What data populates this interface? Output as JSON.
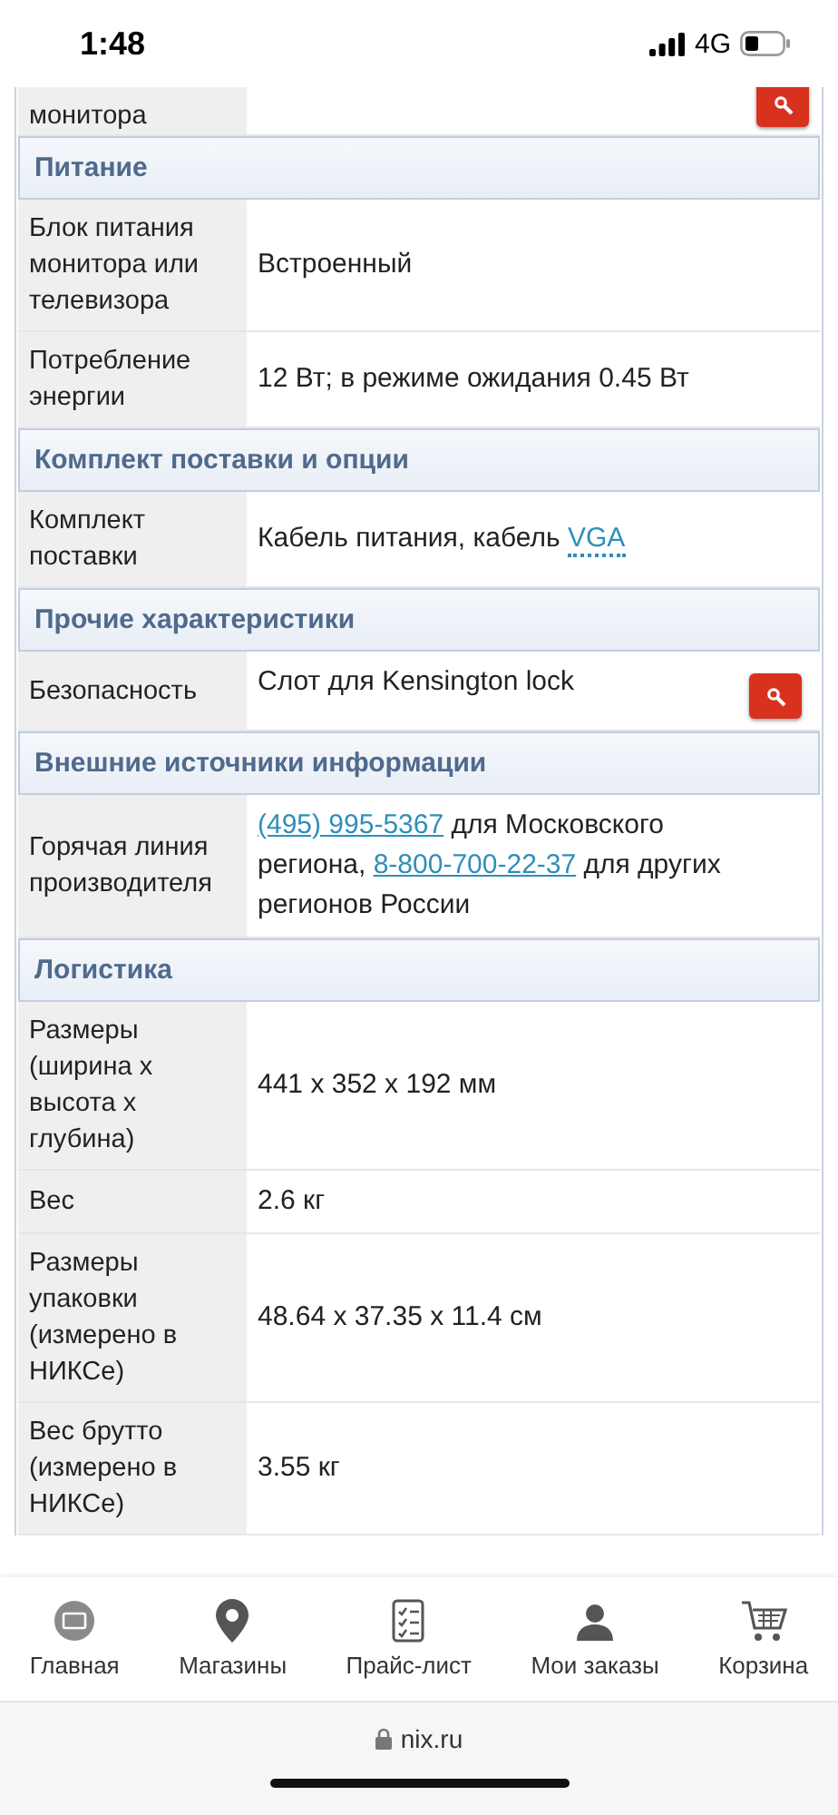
{
  "status_bar": {
    "time": "1:48",
    "network": "4G"
  },
  "spec_rows": [
    {
      "kind": "row",
      "label": "монитора",
      "partial": true,
      "search": true,
      "parts": []
    },
    {
      "kind": "header",
      "label": "Питание"
    },
    {
      "kind": "row",
      "label": "Блок питания монитора или телевизора",
      "partial": false,
      "search": false,
      "parts": [
        {
          "kind": "text",
          "text": "Встроенный"
        }
      ]
    },
    {
      "kind": "row",
      "label": "Потребление энергии",
      "partial": false,
      "search": false,
      "parts": [
        {
          "kind": "text",
          "text": "12 Вт; в режиме ожидания 0.45 Вт"
        }
      ]
    },
    {
      "kind": "header",
      "label": "Комплект поставки и опции"
    },
    {
      "kind": "row",
      "label": "Комплект поставки",
      "partial": false,
      "search": false,
      "parts": [
        {
          "kind": "text",
          "text": "Кабель питания, кабель "
        },
        {
          "kind": "term",
          "text": "VGA"
        }
      ]
    },
    {
      "kind": "header",
      "label": "Прочие характеристики"
    },
    {
      "kind": "row",
      "label": "Безопасность",
      "partial": false,
      "search": true,
      "parts": [
        {
          "kind": "text",
          "text": "Слот для Kensington lock"
        }
      ]
    },
    {
      "kind": "header",
      "label": "Внешние источники информации"
    },
    {
      "kind": "row",
      "label": "Горячая линия производителя",
      "partial": false,
      "search": false,
      "parts": [
        {
          "kind": "link",
          "text": "(495) 995-5367"
        },
        {
          "kind": "text",
          "text": " для Московского региона, "
        },
        {
          "kind": "link",
          "text": "8-800-700-22-37"
        },
        {
          "kind": "text",
          "text": " для других регионов России"
        }
      ]
    },
    {
      "kind": "header",
      "label": "Логистика"
    },
    {
      "kind": "row",
      "label": "Размеры (ширина x высота x глубина)",
      "partial": false,
      "search": false,
      "parts": [
        {
          "kind": "text",
          "text": "441 x 352 x 192 мм"
        }
      ]
    },
    {
      "kind": "row",
      "label": "Вес",
      "partial": false,
      "search": false,
      "parts": [
        {
          "kind": "text",
          "text": "2.6 кг"
        }
      ]
    },
    {
      "kind": "row",
      "label": "Размеры упаковки (измерено в НИКСе)",
      "partial": false,
      "search": false,
      "parts": [
        {
          "kind": "text",
          "text": "48.64 x 37.35 x 11.4 см"
        }
      ]
    },
    {
      "kind": "row",
      "label": "Вес брутто (измерено в НИКСе)",
      "partial": false,
      "search": false,
      "parts": [
        {
          "kind": "text",
          "text": "3.55 кг"
        }
      ]
    }
  ],
  "tab_bar": [
    {
      "kind": "logo",
      "label": "Главная"
    },
    {
      "kind": "pin",
      "label": "Магазины"
    },
    {
      "kind": "list",
      "label": "Прайс-лист"
    },
    {
      "kind": "user",
      "label": "Мои заказы"
    },
    {
      "kind": "cart",
      "label": "Корзина"
    }
  ],
  "address_bar": {
    "url": "nix.ru"
  }
}
